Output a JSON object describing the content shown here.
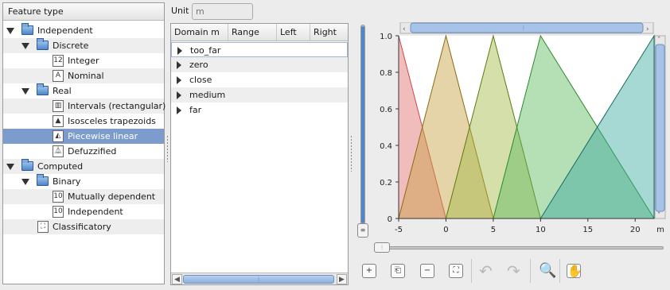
{
  "tree": {
    "header": "Feature type",
    "items": [
      {
        "label": "Independent",
        "level": 0,
        "kind": "folder",
        "expanded": true,
        "icon": "folder-icon"
      },
      {
        "label": "Discrete",
        "level": 1,
        "kind": "folder",
        "expanded": true,
        "icon": "folder-icon"
      },
      {
        "label": "Integer",
        "level": 2,
        "kind": "leaf",
        "icon": "integer-icon",
        "glyph": "12"
      },
      {
        "label": "Nominal",
        "level": 2,
        "kind": "leaf",
        "icon": "nominal-icon",
        "glyph": "A"
      },
      {
        "label": "Real",
        "level": 1,
        "kind": "folder",
        "expanded": true,
        "icon": "folder-icon"
      },
      {
        "label": "Intervals (rectangular)",
        "level": 2,
        "kind": "leaf",
        "icon": "intervals-icon",
        "glyph": "▥"
      },
      {
        "label": "Isosceles trapezoids",
        "level": 2,
        "kind": "leaf",
        "icon": "trapezoid-icon",
        "glyph": "▲"
      },
      {
        "label": "Piecewise linear",
        "level": 2,
        "kind": "leaf",
        "icon": "piecewise-linear-icon",
        "glyph": "◭",
        "selected": true
      },
      {
        "label": "Defuzzified",
        "level": 2,
        "kind": "leaf",
        "icon": "defuzzified-icon",
        "glyph": "⏅"
      },
      {
        "label": "Computed",
        "level": 0,
        "kind": "folder",
        "expanded": true,
        "icon": "folder-icon"
      },
      {
        "label": "Binary",
        "level": 1,
        "kind": "folder",
        "expanded": true,
        "icon": "folder-icon"
      },
      {
        "label": "Mutually dependent",
        "level": 2,
        "kind": "leaf",
        "icon": "mutually-dependent-icon",
        "glyph": "10"
      },
      {
        "label": "Independent",
        "level": 2,
        "kind": "leaf",
        "icon": "binary-independent-icon",
        "glyph": "10"
      },
      {
        "label": "Classificatory",
        "level": 1,
        "kind": "leaf",
        "icon": "classificatory-icon",
        "glyph": "⛶"
      }
    ]
  },
  "unit": {
    "label": "Unit",
    "placeholder": "m"
  },
  "table": {
    "columns": [
      "Domain m",
      "Range",
      "Left",
      "Right"
    ],
    "rows": [
      "too_far",
      "zero",
      "close",
      "medium",
      "far"
    ]
  },
  "colors": {
    "selection": "#7c9ccd",
    "accent": "#4f86c8",
    "series": [
      "#e06a6a",
      "#c8a040",
      "#a0b840",
      "#5cb85c",
      "#3aa8a0"
    ]
  },
  "chart_data": {
    "type": "area",
    "x_tick_labels": [
      "-5",
      "0",
      "5",
      "10",
      "15",
      "20"
    ],
    "x_unit_label": "m",
    "y_tick_labels": [
      "0",
      "0.2",
      "0.4",
      "0.6",
      "0.8",
      "1.0"
    ],
    "xlim": [
      -5,
      22
    ],
    "ylim": [
      0,
      1
    ],
    "series": [
      {
        "x": [
          -5,
          0
        ],
        "y": [
          1,
          0
        ],
        "fill": "#e06a6a",
        "stroke": "#c84a4a"
      },
      {
        "x": [
          -5,
          0,
          5
        ],
        "y": [
          0,
          1,
          0
        ],
        "fill": "#c8a040",
        "stroke": "#8a6a10"
      },
      {
        "x": [
          0,
          5,
          10
        ],
        "y": [
          0,
          1,
          0
        ],
        "fill": "#a0b840",
        "stroke": "#5a7a10"
      },
      {
        "x": [
          5,
          10,
          22
        ],
        "y": [
          0,
          1,
          0
        ],
        "fill": "#5cb85c",
        "stroke": "#2a8a2a"
      },
      {
        "x": [
          10,
          22
        ],
        "y": [
          0,
          1
        ],
        "fill": "#3aa8a0",
        "stroke": "#1a6a60"
      }
    ]
  },
  "toolbar": {
    "buttons": [
      {
        "name": "add-icon",
        "glyph": "+"
      },
      {
        "name": "insert-icon",
        "glyph": "⎗"
      },
      {
        "name": "remove-icon",
        "glyph": "−"
      },
      {
        "name": "fit-icon",
        "glyph": "⛶"
      }
    ],
    "actions": [
      {
        "name": "undo-icon",
        "glyph": "↶"
      },
      {
        "name": "redo-icon",
        "glyph": "↷"
      },
      {
        "name": "zoom-icon",
        "glyph": "🔍"
      },
      {
        "name": "pan-icon",
        "glyph": "✋"
      }
    ]
  }
}
